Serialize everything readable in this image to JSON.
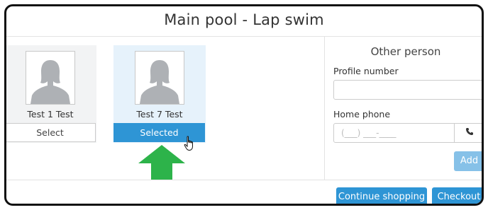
{
  "dialog": {
    "title": "Main pool - Lap swim"
  },
  "people": [
    {
      "name": "Test 1 Test",
      "button_label": "Select",
      "selected": false
    },
    {
      "name": "Test 7 Test",
      "button_label": "Selected",
      "selected": true
    }
  ],
  "other_person": {
    "heading": "Other person",
    "profile_label": "Profile number",
    "profile_value": "",
    "phone_label": "Home phone",
    "phone_placeholder": "(___) ___-____",
    "phone_addon_icon": "phone-icon",
    "add_label": "Add"
  },
  "footer": {
    "continue_label": "Continue shopping",
    "checkout_label": "Checkout"
  },
  "colors": {
    "primary": "#2e95d5",
    "primary_light": "#86c1e8",
    "selected_card": "#e6f2fb",
    "card": "#f2f3f4",
    "annotation_arrow": "#2db34a"
  }
}
